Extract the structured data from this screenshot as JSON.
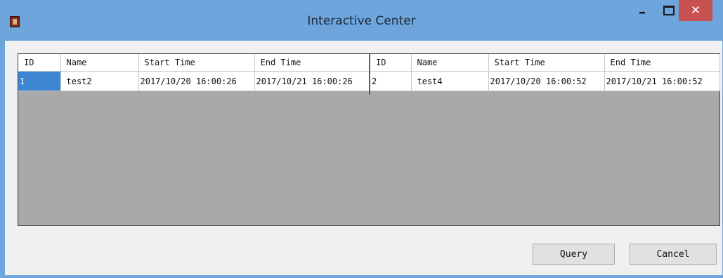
{
  "window": {
    "title": "Interactive Center",
    "close_glyph": "✕",
    "minimize_glyph": "–"
  },
  "grids": [
    {
      "columns": [
        "ID",
        "Name",
        "Start Time",
        "End Time"
      ],
      "rows": [
        {
          "id": "1",
          "name": "test2",
          "start": "2017/10/20 16:00:26",
          "end": "2017/10/21 16:00:26"
        }
      ]
    },
    {
      "columns": [
        "ID",
        "Name",
        "Start Time",
        "End Time"
      ],
      "rows": [
        {
          "id": "2",
          "name": "test4",
          "start": "2017/10/20 16:00:52",
          "end": "2017/10/21 16:00:52"
        }
      ]
    }
  ],
  "buttons": {
    "query": "Query",
    "cancel": "Cancel"
  },
  "colors": {
    "titlebar": "#6fa5dd",
    "selection": "#3d86d4",
    "close": "#c75050"
  }
}
